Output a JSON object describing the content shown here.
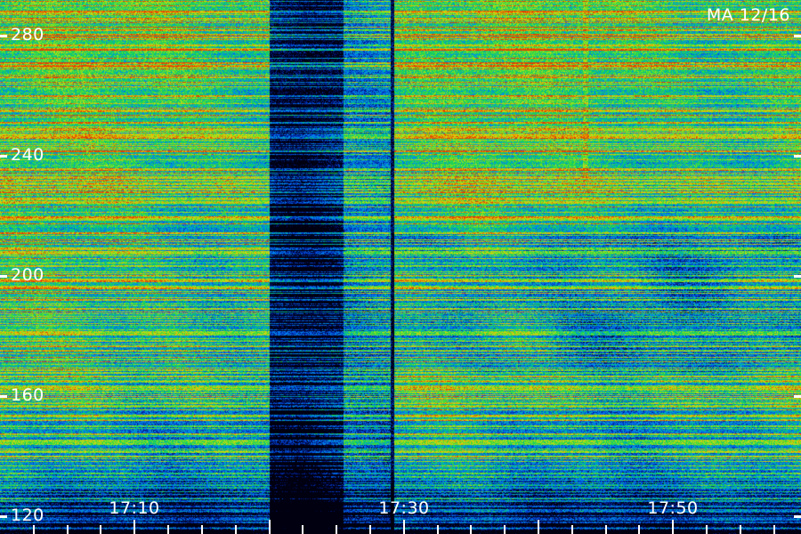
{
  "chart_data": {
    "type": "heatmap",
    "title": "",
    "xlabel": "",
    "ylabel": "",
    "stamp": "MA 12/16",
    "y_ticks": [
      "280",
      "240",
      "200",
      "160",
      "120"
    ],
    "y_tick_values": [
      280,
      240,
      200,
      160,
      120
    ],
    "ylim": [
      114,
      292
    ],
    "x_ticks": [
      "17:10",
      "17:30",
      "17:50"
    ],
    "x_tick_values_minutes": [
      10,
      30,
      50
    ],
    "xlim_minutes": [
      0,
      59.5
    ],
    "colormap": [
      "#000010",
      "#001a8c",
      "#0050e0",
      "#0090f0",
      "#00c878",
      "#40e030",
      "#b0e020",
      "#f0c000",
      "#e04000"
    ],
    "features": [
      {
        "name": "dark vertical band",
        "start_minute": 20,
        "end_minute": 25.5
      },
      {
        "name": "data gap line",
        "minute": 29.1
      },
      {
        "name": "bright streak",
        "minute": 43.5
      }
    ]
  }
}
